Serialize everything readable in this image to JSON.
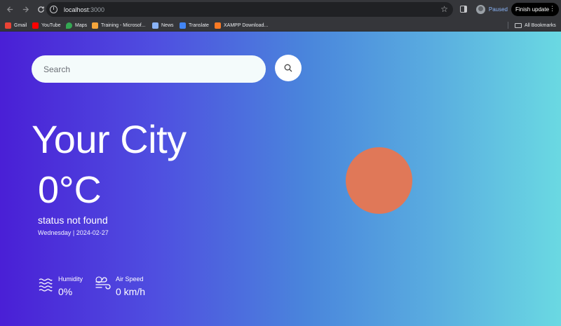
{
  "browser": {
    "url_host": "localhost",
    "url_port": ":3000",
    "profile_label": "Paused",
    "update_button_label": "Finish update",
    "bookmarks": [
      {
        "label": "Gmail",
        "color": "#ea4335"
      },
      {
        "label": "YouTube",
        "color": "#ff0000"
      },
      {
        "label": "Maps",
        "color": "#34a853"
      },
      {
        "label": "Training - Microsof...",
        "color": "#f4a53c"
      },
      {
        "label": "News",
        "color": "#8ab4f8"
      },
      {
        "label": "Translate",
        "color": "#4285f4"
      },
      {
        "label": "XAMPP Download...",
        "color": "#fb7a24"
      }
    ],
    "all_bookmarks_label": "All Bookmarks"
  },
  "weather": {
    "search_placeholder": "Search",
    "city": "Your City",
    "temperature": "0°C",
    "status": "status not found",
    "date": "Wednesday | 2024-02-27",
    "humidity_label": "Humidity",
    "humidity_value": "0%",
    "wind_label": "Air Speed",
    "wind_value": "0 km/h",
    "sun_color": "#e07858"
  }
}
